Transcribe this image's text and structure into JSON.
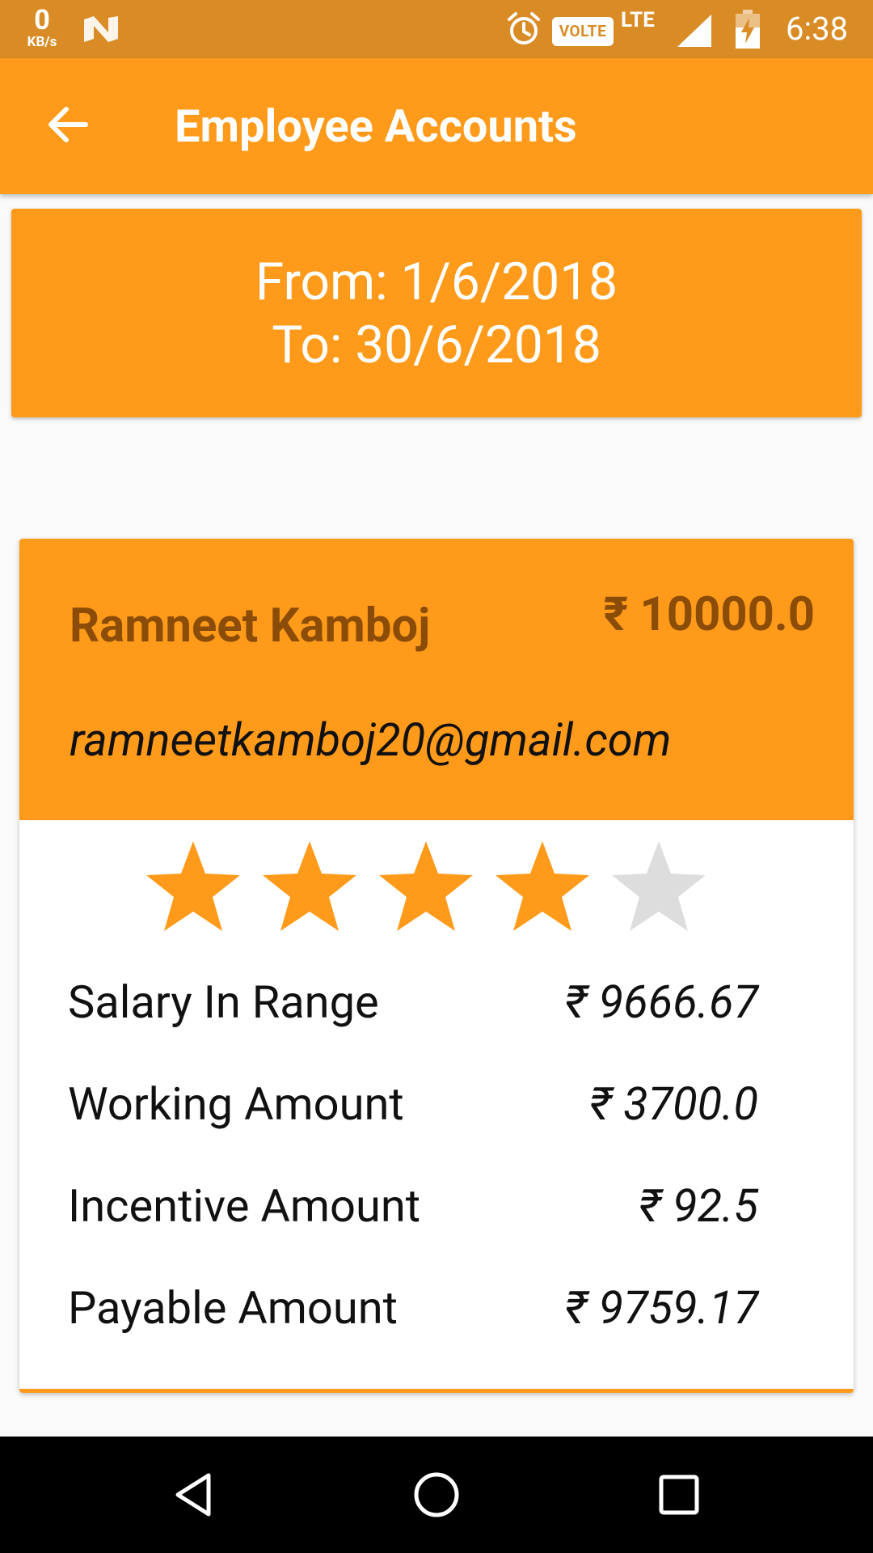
{
  "status_bar": {
    "speed_value": "0",
    "speed_unit": "KB/s",
    "volte": "VOLTE",
    "network": "LTE",
    "time": "6:38"
  },
  "app_bar": {
    "back_icon": "arrow-left-icon",
    "title": "Employee Accounts"
  },
  "date_range": {
    "from": "From: 1/6/2018",
    "to": "To: 30/6/2018"
  },
  "employee": {
    "name": "Ramneet Kamboj",
    "salary": "₹ 10000.0",
    "email": "ramneetkamboj20@gmail.com",
    "rating": 4,
    "rating_max": 5,
    "rows": [
      {
        "label": "Salary In Range",
        "value": "₹ 9666.67"
      },
      {
        "label": "Working Amount",
        "value": "₹ 3700.0"
      },
      {
        "label": "Incentive Amount",
        "value": "₹ 92.5"
      },
      {
        "label": "Payable Amount",
        "value": "₹ 9759.17"
      }
    ]
  },
  "colors": {
    "accent": "#ff9a1a",
    "status_bar": "#d98c26",
    "header_text": "#8a4c06",
    "star_filled": "#ff9a1a",
    "star_empty": "#dddddd"
  },
  "nav_bar": {
    "back": "triangle-back-icon",
    "home": "circle-home-icon",
    "recents": "square-recents-icon"
  }
}
